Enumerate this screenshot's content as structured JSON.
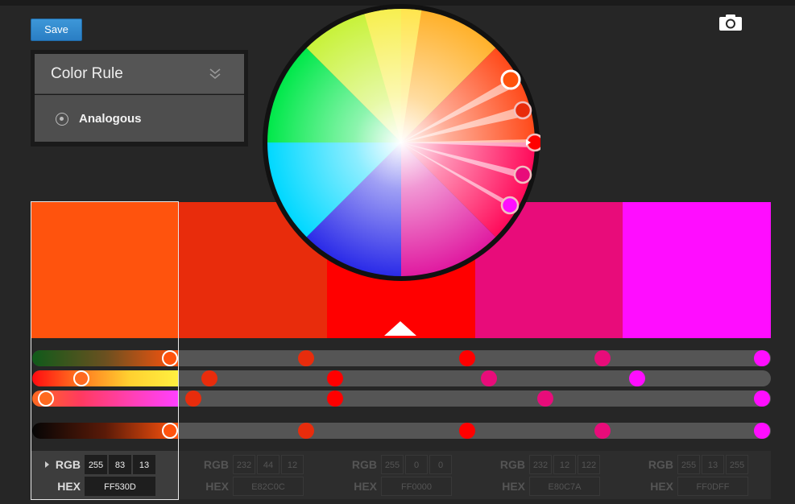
{
  "toolbar": {
    "save_label": "Save",
    "camera_icon": "camera-icon"
  },
  "color_rule": {
    "title": "Color Rule",
    "expand_icon": "double-chevron-down-icon",
    "selected_option": "Analogous"
  },
  "swatches": [
    {
      "hex": "#FF530D",
      "rgb": [
        "255",
        "83",
        "13"
      ],
      "hex_label": "FF530D",
      "selected": true
    },
    {
      "hex": "#E82C0C",
      "rgb": [
        "232",
        "44",
        "12"
      ],
      "hex_label": "E82C0C",
      "selected": false
    },
    {
      "hex": "#FF0000",
      "rgb": [
        "255",
        "0",
        "0"
      ],
      "hex_label": "FF0000",
      "selected": false
    },
    {
      "hex": "#E80C7A",
      "rgb": [
        "232",
        "12",
        "122"
      ],
      "hex_label": "E80C7A",
      "selected": false
    },
    {
      "hex": "#FF0DFF",
      "rgb": [
        "255",
        "13",
        "255"
      ],
      "hex_label": "FF0DFF",
      "selected": false
    }
  ],
  "labels": {
    "rgb": "RGB",
    "hex": "HEX"
  },
  "colors": {
    "accent": "#2a86cf",
    "background": "#262626",
    "panel": "#555555"
  }
}
